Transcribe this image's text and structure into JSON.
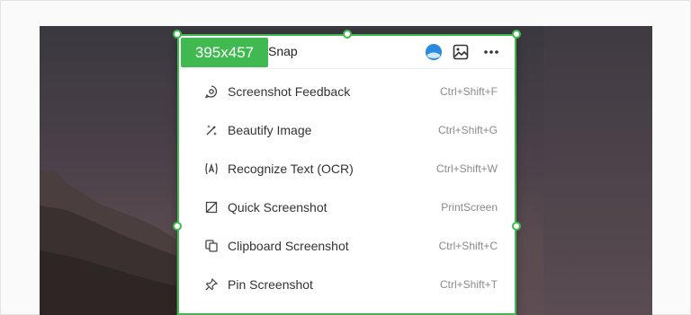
{
  "app": {
    "name": "Snap"
  },
  "selection": {
    "size_label": "395x457"
  },
  "header_icons": [
    "avatar-icon",
    "image-icon",
    "more-icon"
  ],
  "menu": {
    "items": [
      {
        "label": "Screenshot Feedback",
        "shortcut": "Ctrl+Shift+F",
        "icon": "feedback-icon"
      },
      {
        "label": "Beautify Image",
        "shortcut": "Ctrl+Shift+G",
        "icon": "magic-wand-icon"
      },
      {
        "label": "Recognize Text (OCR)",
        "shortcut": "Ctrl+Shift+W",
        "icon": "ocr-icon"
      },
      {
        "label": "Quick Screenshot",
        "shortcut": "PrintScreen",
        "icon": "crop-icon"
      },
      {
        "label": "Clipboard Screenshot",
        "shortcut": "Ctrl+Shift+C",
        "icon": "clipboard-icon"
      },
      {
        "label": "Pin Screenshot",
        "shortcut": "Ctrl+Shift+T",
        "icon": "pin-icon"
      }
    ]
  },
  "colors": {
    "selection": "#3fb950",
    "avatar": "#2a8be0"
  }
}
